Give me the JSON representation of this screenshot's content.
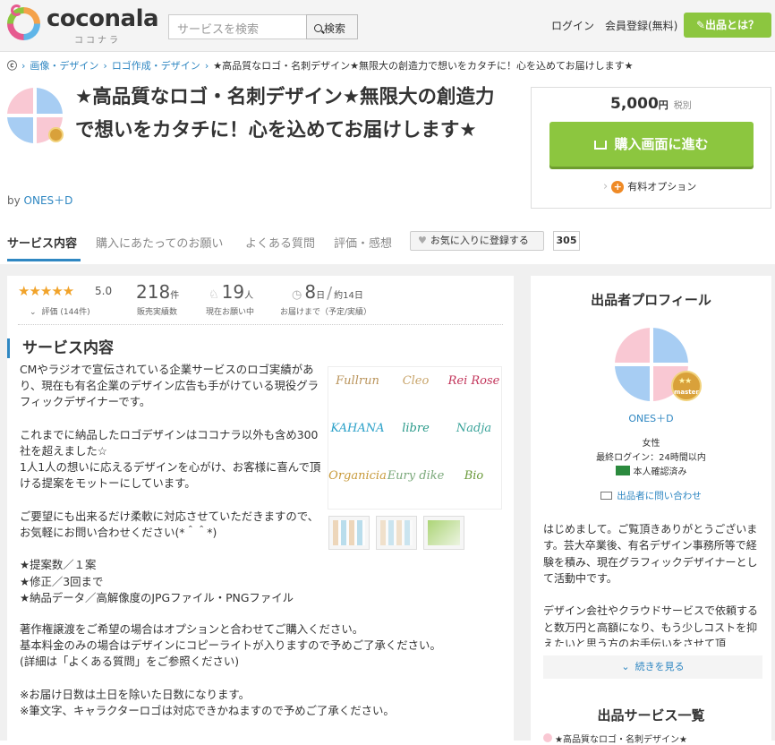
{
  "header": {
    "logo_text": "coconala",
    "logo_sub": "ココナラ",
    "search_placeholder": "サービスを検索",
    "search_button": "検索",
    "login": "ログイン",
    "register": "会員登録(無料)",
    "sell_button": "出品とは？"
  },
  "breadcrumb": {
    "home_icon": "coconala-home-icon",
    "items": [
      "画像・デザイン",
      "ロゴ作成・デザイン"
    ],
    "current": "★高品質なロゴ・名刺デザイン★無限大の創造力で想いをカタチに！心を込めてお届けします★"
  },
  "product": {
    "title": "★高品質なロゴ・名刺デザイン★無限大の創造力で想いをカタチに！心を込めてお届けします★",
    "by_prefix": "by",
    "seller": "ONES＋D"
  },
  "purchase": {
    "price": "5,000",
    "yen": "円",
    "tax": "税別",
    "buy_button": "購入画面に進む",
    "option_label": "有料オプション"
  },
  "tabs": [
    "サービス内容",
    "購入にあたってのお願い",
    "よくある質問",
    "評価・感想"
  ],
  "favorite": {
    "label": "お気に入りに登録する",
    "count": "305"
  },
  "stats": {
    "stars": "★★★★★",
    "rating": "5.0",
    "rating_count": "評価 (144件)",
    "sales": "218",
    "sales_unit": "件",
    "sales_label": "販売実績数",
    "requests": "19",
    "requests_unit": "人",
    "requests_label": "現在お願い中",
    "days": "8",
    "days_unit": "日",
    "days_approx": "約14日",
    "days_label": "お届けまで（予定/実績）"
  },
  "service": {
    "heading": "サービス内容",
    "description_top": "CMやラジオで宣伝されている企業サービスのロゴ実績があり、現在も有名企業のデザイン広告も手がけている現役グラフィックデザイナーです。\n\nこれまでに納品したロゴデザインはココナラ以外も含め300社を超えました☆\n1人1人の想いに応えるデザインを心がけ、お客様に喜んで頂ける提案をモットーにしています。\n\nご要望にも出来るだけ柔軟に対応させていただきますので、お気軽にお問い合わせください(*＾＾*)\n\n★提案数／１案\n★修正／3回まで\n★納品データ／高解像度のJPGファイル・PNGファイル",
    "description_bottom": "著作権譲渡をご希望の場合はオプションと合わせてご購入ください。\n基本料金のみの場合はデザインにコピーライトが入りますので予めご了承ください。\n(詳細は「よくある質問」をご参照ください)\n\n※お届け日数は土日を除いた日数になります。\n※筆文字、キャラクターロゴは対応できかねますので予めご了承ください。",
    "gallery": [
      {
        "text": "Fullrun",
        "color": "#b9935a"
      },
      {
        "text": "Cleo",
        "color": "#c8a46a"
      },
      {
        "text": "Rei Rose",
        "color": "#c2345a"
      },
      {
        "text": "KAHANA",
        "color": "#2aa0c8"
      },
      {
        "text": "libre",
        "color": "#2a9a8a"
      },
      {
        "text": "Nadja",
        "color": "#3aa39a"
      },
      {
        "text": "Organicia",
        "color": "#c89a3a"
      },
      {
        "text": "Eury dike",
        "color": "#7aa87a"
      },
      {
        "text": "Bio",
        "color": "#6a9a3a"
      }
    ]
  },
  "profile": {
    "heading": "出品者プロフィール",
    "badge": "master",
    "name": "ONES＋D",
    "gender": "女性",
    "last_login": "最終ログイン：24時間以内",
    "verified": "本人確認済み",
    "contact": "出品者に問い合わせ",
    "bio": "はじめまして。ご覧頂きありがとうございます。芸大卒業後、有名デザイン事務所等で経験を積み、現在グラフィックデザイナーとして活動中です。\n\nデザイン会社やクラウドサービスで依頼すると数万円と高額になり、もう少しコストを抑えたいと思う方のお手伝いをさせて頂",
    "more": "続きを見る",
    "services_heading": "出品サービス一覧",
    "service_preview": "★高品質なロゴ・名刺デザイン★"
  }
}
